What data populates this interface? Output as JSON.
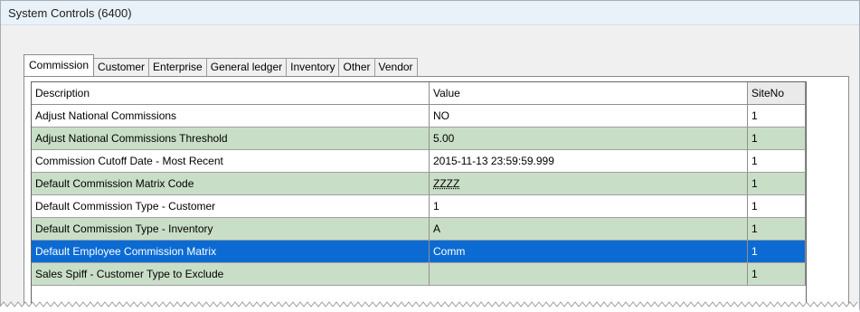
{
  "window": {
    "title": "System Controls (6400)"
  },
  "tabs": [
    {
      "label": "Commission",
      "active": true
    },
    {
      "label": "Customer",
      "active": false
    },
    {
      "label": "Enterprise",
      "active": false
    },
    {
      "label": "General ledger",
      "active": false
    },
    {
      "label": "Inventory",
      "active": false
    },
    {
      "label": "Other",
      "active": false
    },
    {
      "label": "Vendor",
      "active": false
    }
  ],
  "grid": {
    "columns": [
      "Description",
      "Value",
      "SiteNo"
    ],
    "rows": [
      {
        "description": "Adjust National Commissions",
        "value": "NO",
        "site_no": "1",
        "style": "white"
      },
      {
        "description": "Adjust National Commissions Threshold",
        "value": "5.00",
        "site_no": "1",
        "style": "green"
      },
      {
        "description": "Commission Cutoff Date - Most Recent",
        "value": "2015-11-13 23:59:59.999",
        "site_no": "1",
        "style": "white"
      },
      {
        "description": "Default Commission Matrix Code",
        "value": "ZZZZ",
        "site_no": "1",
        "style": "green"
      },
      {
        "description": "Default Commission Type - Customer",
        "value": "1",
        "site_no": "1",
        "style": "white"
      },
      {
        "description": "Default Commission Type - Inventory",
        "value": "A",
        "site_no": "1",
        "style": "green"
      },
      {
        "description": "Default Employee Commission Matrix",
        "value": "Comm",
        "site_no": "1",
        "style": "selected"
      },
      {
        "description": "Sales Spiff - Customer Type to Exclude",
        "value": "",
        "site_no": "1",
        "style": "green"
      }
    ]
  },
  "colors": {
    "row_green": "#c9dec7",
    "row_selected": "#0c6bd3",
    "title_bar": "#e9f1f9"
  }
}
